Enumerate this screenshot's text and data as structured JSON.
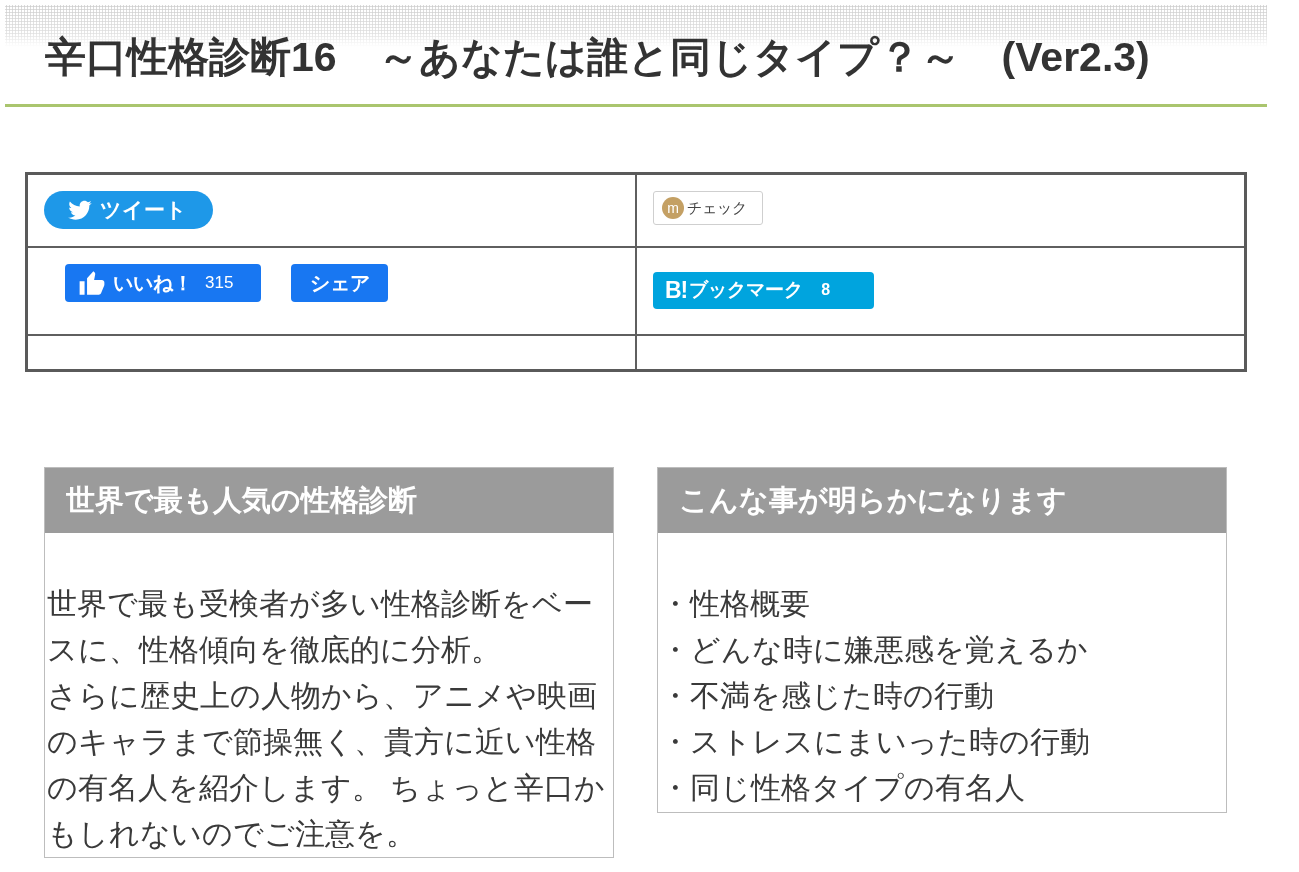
{
  "page_title": "辛口性格診断16　～あなたは誰と同じタイプ？～　(Ver2.3)",
  "share_table": {
    "rows": [
      {
        "cells": [
          {
            "buttons": [
              {
                "kind": "tweet",
                "label": "ツイート"
              }
            ]
          },
          {
            "buttons": [
              {
                "kind": "check",
                "logo": "m",
                "label": "チェック"
              }
            ]
          }
        ]
      },
      {
        "cells": [
          {
            "buttons": [
              {
                "kind": "like",
                "label": "いいね！",
                "count": "315"
              },
              {
                "kind": "share",
                "label": "シェア"
              }
            ]
          },
          {
            "buttons": [
              {
                "kind": "bookmark",
                "logo": "B!",
                "label": "ブックマーク",
                "count": "8"
              }
            ]
          }
        ]
      },
      {
        "cells": [
          {},
          {}
        ]
      }
    ]
  },
  "panels": [
    {
      "title": "世界で最も人気の性格診断",
      "paragraphs": [
        "世界で最も受検者が多い性格診断をベースに、性格傾向を徹底的に分析。",
        "さらに歴史上の人物から、アニメや映画のキャラまで節操無く、貴方に近い性格の有名人を紹介します。 ちょっと辛口かもしれないのでご注意を。"
      ]
    },
    {
      "title": "こんな事が明らかになります",
      "items": [
        "・性格概要",
        "・どんな時に嫌悪感を覚えるか",
        "・不満を感じた時の行動",
        "・ストレスにまいった時の行動",
        "・同じ性格タイプの有名人"
      ]
    }
  ]
}
